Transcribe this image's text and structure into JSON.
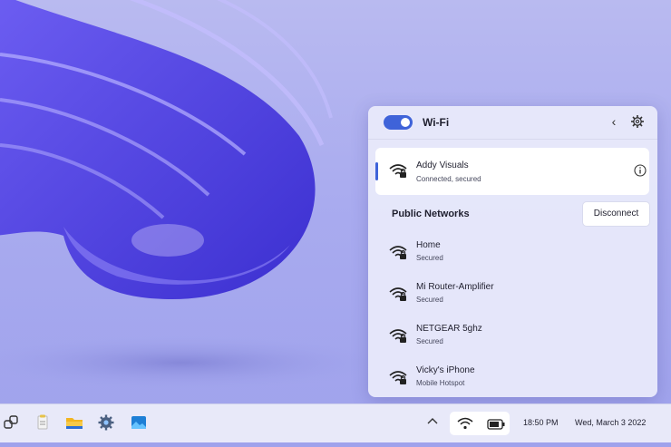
{
  "wifi_panel": {
    "title": "Wi-Fi",
    "wifi_enabled": true,
    "connected_network": {
      "name": "Addy Visuals",
      "status": "Connected, secured",
      "icon": "wifi-secured-icon"
    },
    "disconnect_label": "Disconnect",
    "section_label": "Public Networks",
    "networks": [
      {
        "name": "Home",
        "status": "Secured"
      },
      {
        "name": "Mi Router-Amplifier",
        "status": "Secured"
      },
      {
        "name": "NETGEAR 5ghz",
        "status": "Secured"
      },
      {
        "name": "Vicky's iPhone",
        "status": "Mobile Hotspot"
      }
    ]
  },
  "taskbar": {
    "icons": [
      "task-view-icon",
      "notepad-icon",
      "file-explorer-icon",
      "settings-icon",
      "photos-icon"
    ],
    "tray_icons": [
      "chevron-up-icon",
      "wifi-icon",
      "battery-icon"
    ],
    "time": "18:50 PM",
    "date": "Wed, March 3 2022"
  },
  "colors": {
    "accent": "#3f63d9",
    "wallpaper": "#5a4fe0"
  }
}
